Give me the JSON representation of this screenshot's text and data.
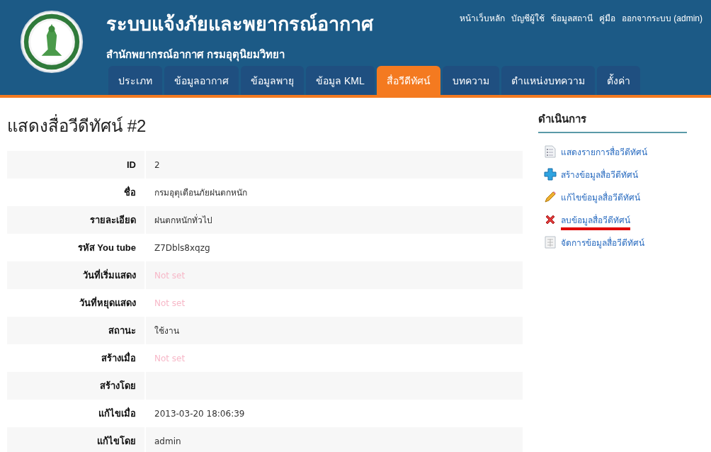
{
  "header": {
    "title": "ระบบแจ้งภัยและพยากรณ์อากาศ",
    "subtitle": "สำนักพยากรณ์อากาศ กรมอุตุนิยมวิทยา",
    "top_links": [
      "หน้าเว็บหลัก",
      "บัญชีผู้ใช้",
      "ข้อมูลสถานี",
      "คู่มือ",
      "ออกจากระบบ (admin)"
    ]
  },
  "tabs": [
    {
      "label": "ประเภท",
      "selected": false
    },
    {
      "label": "ข้อมูลอากาศ",
      "selected": false
    },
    {
      "label": "ข้อมูลพายุ",
      "selected": false
    },
    {
      "label": "ข้อมูล KML",
      "selected": false
    },
    {
      "label": "สื่อวีดีทัศน์",
      "selected": true
    },
    {
      "label": "บทความ",
      "selected": false
    },
    {
      "label": "ตำแหน่งบทความ",
      "selected": false
    },
    {
      "label": "ตั้งค่า",
      "selected": false
    }
  ],
  "page_title": "แสดงสื่อวีดีทัศน์ #2",
  "details": [
    {
      "label": "ID",
      "value": "2"
    },
    {
      "label": "ชื่อ",
      "value": "กรมอุตุเตือนภัยฝนตกหนัก"
    },
    {
      "label": "รายละเอียด",
      "value": "ฝนตกหนักทั่วไป"
    },
    {
      "label": "รหัส You tube",
      "value": "Z7Dbls8xqzg"
    },
    {
      "label": "วันที่เริ่มแสดง",
      "value": "Not set",
      "unset": true
    },
    {
      "label": "วันที่หยุดแสดง",
      "value": "Not set",
      "unset": true
    },
    {
      "label": "สถานะ",
      "value": "ใช้งาน"
    },
    {
      "label": "สร้างเมื่อ",
      "value": "Not set",
      "unset": true
    },
    {
      "label": "สร้างโดย"
    },
    {
      "label": "แก้ไขเมื่อ",
      "value": "2013-03-20 18:06:39"
    },
    {
      "label": "แก้ไขโดย",
      "value": "admin"
    }
  ],
  "operations": {
    "title": "ดำเนินการ",
    "items": [
      {
        "kind": "list",
        "label": "แสดงรายการสื่อวีดีทัศน์",
        "underlined": false
      },
      {
        "kind": "create",
        "label": "สร้างข้อมูลสื่อวีดีทัศน์",
        "underlined": false
      },
      {
        "kind": "edit",
        "label": "แก้ไขข้อมูลสื่อวีดีทัศน์",
        "underlined": false
      },
      {
        "kind": "delete",
        "label": "ลบข้อมูลสื่อวีดีทัศน์",
        "underlined": true
      },
      {
        "kind": "manage",
        "label": "จัดการข้อมูลสื่อวีดีทัศน์",
        "underlined": false
      }
    ]
  }
}
